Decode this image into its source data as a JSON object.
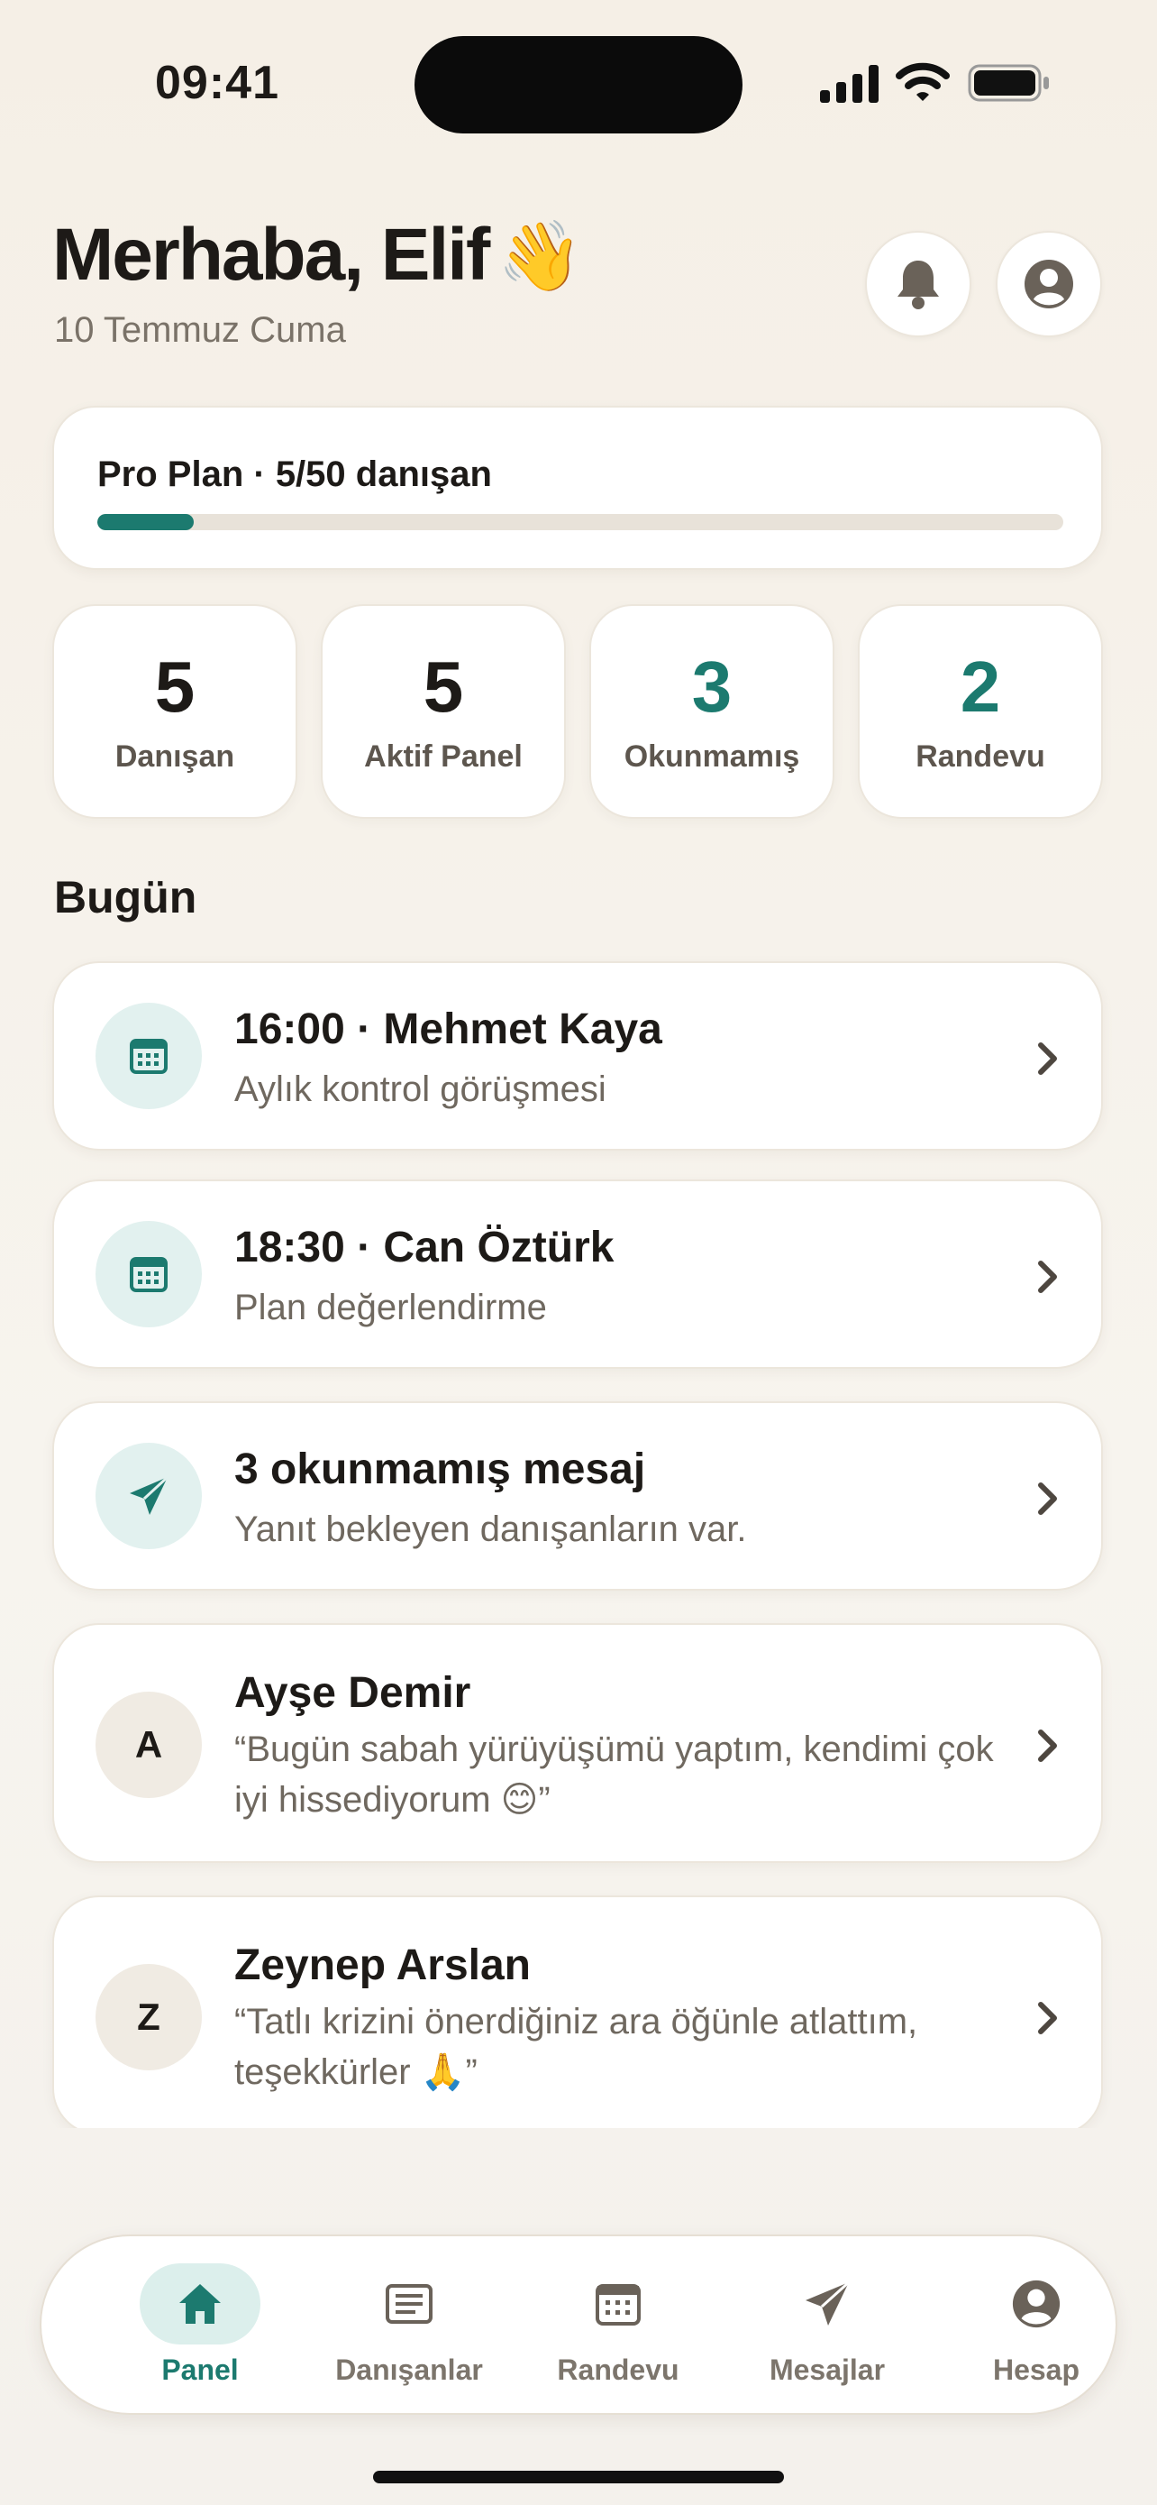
{
  "status_bar": {
    "time": "09:41"
  },
  "header": {
    "greeting": "Merhaba, Elif",
    "greeting_emoji": "👋",
    "date": "10 Temmuz Cuma"
  },
  "plan": {
    "label": "Pro Plan · 5/50 danışan",
    "progress_fraction": 0.1
  },
  "stats": [
    {
      "value": "5",
      "label": "Danışan"
    },
    {
      "value": "5",
      "label": "Aktif Panel"
    },
    {
      "value": "3",
      "label": "Okunmamış"
    },
    {
      "value": "2",
      "label": "Randevu"
    }
  ],
  "today": {
    "title": "Bugün",
    "items": [
      {
        "title": "16:00 · Mehmet Kaya",
        "subtitle": "Aylık kontrol görüşmesi",
        "icon": "calendar-icon"
      },
      {
        "title": "18:30 · Can Öztürk",
        "subtitle": "Plan değerlendirme",
        "icon": "calendar-icon"
      },
      {
        "title": "3 okunmamış mesaj",
        "subtitle": "Yanıt bekleyen danışanların var.",
        "icon": "send-icon"
      },
      {
        "title": "Ayşe Demir",
        "initial": "A",
        "subtitle": "“Bugün sabah yürüyüşümü yaptım, kendimi çok iyi hissediyorum 😊”"
      },
      {
        "title": "Zeynep Arslan",
        "initial": "Z",
        "subtitle": "“Tatlı krizini önerdiğiniz ara öğünle atlattım, teşekkürler 🙏”"
      }
    ]
  },
  "tabs": [
    {
      "label": "Panel",
      "icon": "home-icon",
      "active": true
    },
    {
      "label": "Danışanlar",
      "icon": "list-icon",
      "active": false
    },
    {
      "label": "Randevu",
      "icon": "calendar-icon",
      "active": false
    },
    {
      "label": "Mesajlar",
      "icon": "send-icon",
      "active": false
    },
    {
      "label": "Hesap",
      "icon": "account-icon",
      "active": false
    }
  ],
  "colors": {
    "accent": "#1c7a6f",
    "background": "#f6f2ea"
  }
}
